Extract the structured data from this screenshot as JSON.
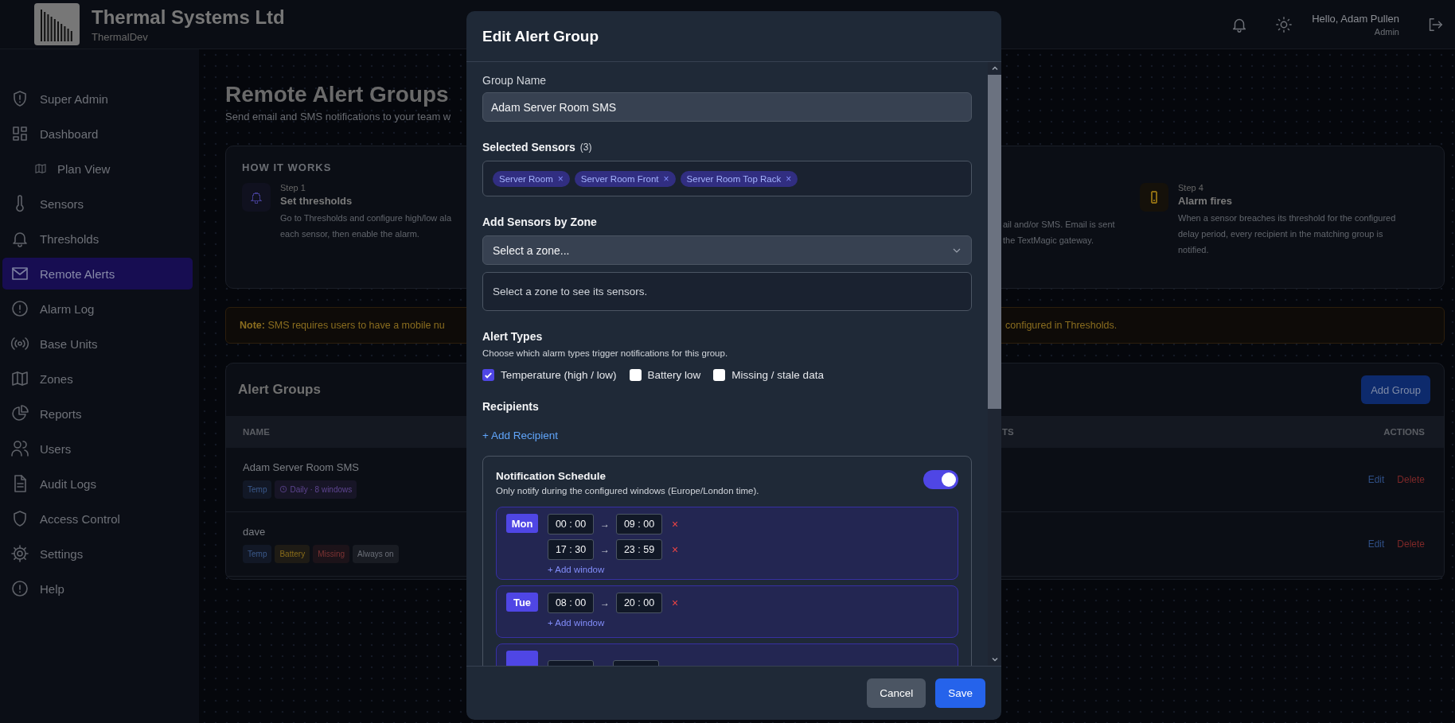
{
  "header": {
    "company": "Thermal Systems Ltd",
    "subtitle": "ThermalDev",
    "greeting": "Hello, Adam Pullen",
    "role": "Admin"
  },
  "sidebar": {
    "items": [
      {
        "label": "Super Admin",
        "selected": false
      },
      {
        "label": "Dashboard",
        "selected": false,
        "children": [
          {
            "label": "Plan View",
            "selected": false
          }
        ]
      },
      {
        "label": "Sensors",
        "selected": false
      },
      {
        "label": "Thresholds",
        "selected": false
      },
      {
        "label": "Remote Alerts",
        "selected": true
      },
      {
        "label": "Alarm Log",
        "selected": false
      },
      {
        "label": "Base Units",
        "selected": false
      },
      {
        "label": "Zones",
        "selected": false
      },
      {
        "label": "Reports",
        "selected": false
      },
      {
        "label": "Users",
        "selected": false
      },
      {
        "label": "Audit Logs",
        "selected": false
      },
      {
        "label": "Access Control",
        "selected": false
      },
      {
        "label": "Settings",
        "selected": false
      },
      {
        "label": "Help",
        "selected": false
      }
    ]
  },
  "page": {
    "title": "Remote Alert Groups",
    "subtitle": "Send email and SMS notifications to your team w"
  },
  "how_it_works": {
    "heading": "HOW IT WORKS",
    "steps": [
      {
        "kind": "step",
        "step": "Step 1",
        "title": "Set thresholds",
        "color": "#3f3a8a",
        "lines": [
          "Go to Thresholds and configure high/low ala",
          "each sensor, then enable the alarm."
        ]
      },
      {
        "kind": "fragment",
        "lines": [
          "ail and/or SMS. Email is sent",
          "the TextMagic gateway."
        ]
      },
      {
        "kind": "step",
        "step": "Step 4",
        "title": "Alarm fires",
        "color": "#8a6a12",
        "lines": [
          "When a sensor breaches its threshold for the configured",
          "delay period, every recipient in the matching group is",
          "notified."
        ]
      }
    ]
  },
  "note": {
    "label": "Note:",
    "text": "SMS requires users to have a mobile nu",
    "continuation": "configured in Thresholds."
  },
  "alert_groups": {
    "title": "Alert Groups",
    "add_button": "Add Group",
    "columns": {
      "name": "NAME",
      "column_3": "TS",
      "actions": "ACTIONS"
    },
    "rows": [
      {
        "name": "Adam Server Room SMS",
        "tags": [
          {
            "label": "Temp",
            "kind": "alert",
            "color": "#3b5a8c"
          },
          {
            "label": "Daily · 8 windows",
            "kind": "schedule",
            "color": "#5e4590"
          }
        ],
        "edit": "Edit",
        "delete": "Delete"
      },
      {
        "name": "dave",
        "tags": [
          {
            "label": "Temp",
            "kind": "alert",
            "color": "#3b5a8c"
          },
          {
            "label": "Battery",
            "kind": "alert",
            "color": "#8a6d1a"
          },
          {
            "label": "Missing",
            "kind": "alert",
            "color": "#7d3333"
          },
          {
            "label": "Always on",
            "kind": "always",
            "color": "#6b6f78"
          }
        ],
        "edit": "Edit",
        "delete": "Delete"
      }
    ]
  },
  "modal": {
    "title": "Edit Alert Group",
    "group_name": {
      "label": "Group Name",
      "value": "Adam Server Room SMS"
    },
    "selected_sensors": {
      "label": "Selected Sensors",
      "count": "(3)",
      "chips": [
        {
          "label": "Server Room",
          "remove": "×"
        },
        {
          "label": "Server Room Front",
          "remove": "×"
        },
        {
          "label": "Server Room Top Rack",
          "remove": "×"
        }
      ]
    },
    "zone": {
      "label": "Add Sensors by Zone",
      "placeholder": "Select a zone...",
      "hint": "Select a zone to see its sensors."
    },
    "alert_types": {
      "label": "Alert Types",
      "description": "Choose which alarm types trigger notifications for this group.",
      "options": [
        {
          "label": "Temperature (high / low)",
          "checked": true
        },
        {
          "label": "Battery low",
          "checked": false
        },
        {
          "label": "Missing / stale data",
          "checked": false
        }
      ]
    },
    "recipients": {
      "label": "Recipients",
      "add": "+ Add Recipient"
    },
    "schedule": {
      "title": "Notification Schedule",
      "description": "Only notify during the configured windows (Europe/London time).",
      "on": true,
      "days": [
        {
          "kind": "day",
          "day": "Mon",
          "windows": [
            {
              "start": "00 : 00",
              "arrow": "→",
              "end": "09 : 00",
              "remove": "×"
            },
            {
              "start": "17 : 30",
              "arrow": "→",
              "end": "23 : 59",
              "remove": "×"
            }
          ],
          "add": "+ Add window"
        },
        {
          "kind": "day",
          "day": "Tue",
          "windows": [
            {
              "start": "08 : 00",
              "arrow": "→",
              "end": "20 : 00",
              "remove": "×"
            }
          ],
          "add": "+ Add window"
        },
        {
          "kind": "cut_off"
        }
      ]
    },
    "cancel": "Cancel",
    "save": "Save"
  }
}
